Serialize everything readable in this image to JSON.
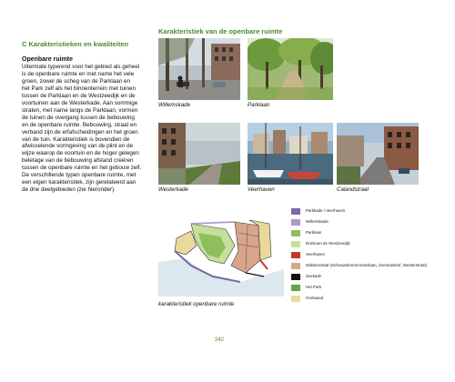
{
  "header": {
    "right_title": "Karakteristiek van de openbare ruimte",
    "left_title": "C Karakteristieken en kwaliteiten"
  },
  "text": {
    "subheading": "Openbare ruimte",
    "lines": [
      "Uitermate typerend voor het gebied als geheel",
      "is de openbare ruimte en met name het vele",
      "groen, zowel de scheg van de Parklaan en",
      "het Park zelf als het binnenterrein met tuinen",
      "tussen de Parklaan en de Westzeedijk en de",
      "voortuinen aan de Westerkade. Aan sommige",
      "straten, met name langs de Parklaan, vormen",
      "de tuinen de overgang tussen de bebouwing",
      "en de openbare ruimte. Bebouwing, straat en",
      "verband zijn de erfafscheidingen en het groen",
      "van de tuin. Karakteristiek is bovendien de",
      "afwisselende vormgeving van de plint en de",
      "wijze waarop de voortuin en de hoger gelegen",
      "beletage van de bebouwing afstand creëren",
      "tussen de openbare ruimte en het gebouw zelf.",
      "De verschillende typen openbare ruimte, met",
      "een eigen karakteristiek, zijn gerelateerd aan",
      "de drie deelgebieden (zie hieronder)."
    ]
  },
  "photos": {
    "captions": [
      "Willemskade",
      "Parklaan",
      "Westerkade",
      "Veerhaven",
      "Calandstraat"
    ]
  },
  "map": {
    "caption": "karakteristiek openbare ruimte"
  },
  "legend": {
    "items": [
      {
        "label": "Parkkade / Veerhaven",
        "color": "#7a68a8"
      },
      {
        "label": "Willemskade",
        "color": "#a99bc8"
      },
      {
        "label": "Parklaan",
        "color": "#8fbf5a"
      },
      {
        "label": "Drieboen de Westzeedijk",
        "color": "#c7df9b"
      },
      {
        "label": "Veerhaven",
        "color": "#c03a2b"
      },
      {
        "label": "Middenstraat (Scheepstimmermanslaan, Zeemanshof, Westerstraat)",
        "color": "#d9a58a"
      },
      {
        "label": "Zeekade",
        "color": "#111111"
      },
      {
        "label": "Het Park",
        "color": "#5fa845"
      },
      {
        "label": "Oorkaand",
        "color": "#e9d99a"
      }
    ]
  },
  "footer": {
    "page_number": "242"
  }
}
